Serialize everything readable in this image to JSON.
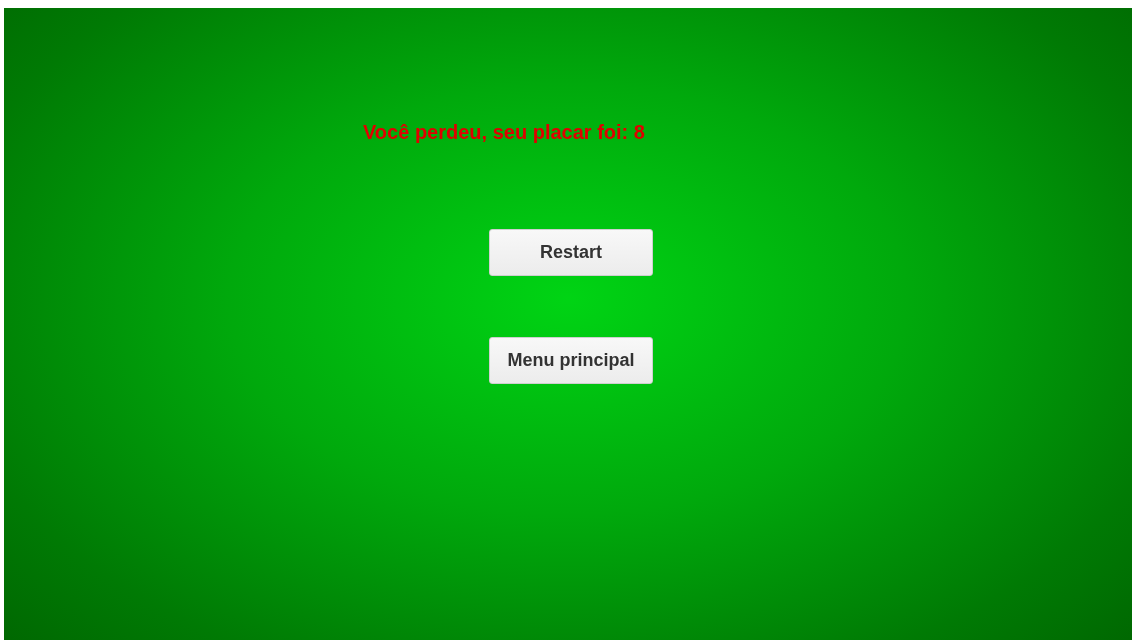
{
  "message": "Você perdeu, seu placar foi: 8",
  "buttons": [
    {
      "label": "Restart"
    },
    {
      "label": "Menu principal"
    }
  ]
}
